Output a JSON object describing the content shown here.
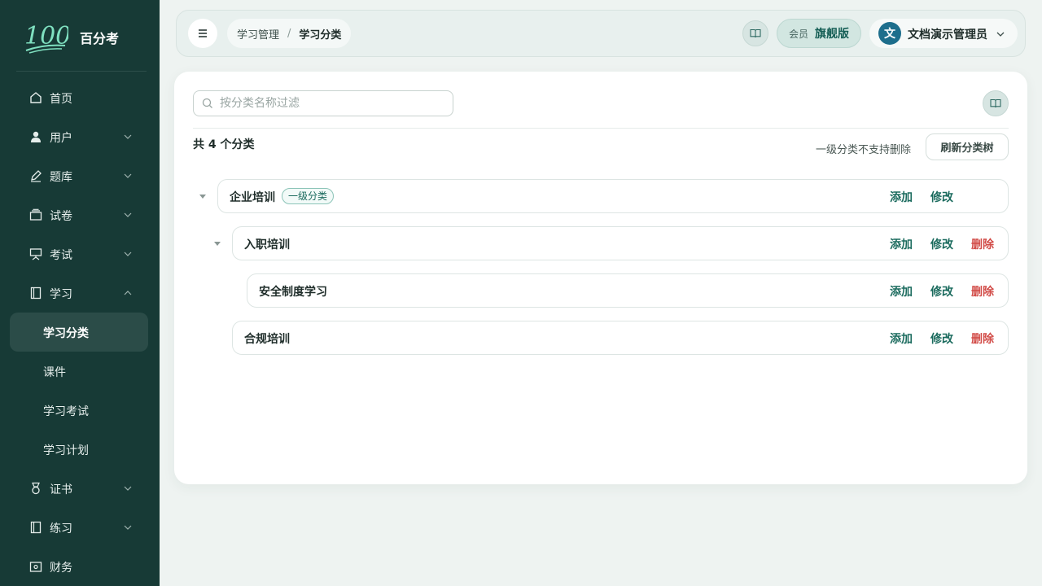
{
  "app": {
    "brand": "百分考",
    "logo_text": "100"
  },
  "sidebar": {
    "items": [
      {
        "label": "首页",
        "icon": "home-icon"
      },
      {
        "label": "用户",
        "icon": "user-icon"
      },
      {
        "label": "题库",
        "icon": "pen-icon"
      },
      {
        "label": "试卷",
        "icon": "stack-icon"
      },
      {
        "label": "考试",
        "icon": "presentation-icon"
      },
      {
        "label": "学习",
        "icon": "notebook-icon"
      },
      {
        "label": "证书",
        "icon": "medal-icon"
      },
      {
        "label": "练习",
        "icon": "notebook-icon"
      },
      {
        "label": "财务",
        "icon": "wallet-icon"
      }
    ],
    "sub_items": [
      {
        "label": "学习分类",
        "active": true
      },
      {
        "label": "课件"
      },
      {
        "label": "学习考试"
      },
      {
        "label": "学习计划"
      }
    ]
  },
  "header": {
    "breadcrumb": [
      "学习管理",
      "学习分类"
    ],
    "breadcrumb_sep": "/",
    "member_label": "会员",
    "member_tier": "旗舰版",
    "user_avatar": "文",
    "user_name": "文档演示管理员"
  },
  "main": {
    "search_placeholder": "按分类名称过滤",
    "count_text": "共 4 个分类",
    "hint": "一级分类不支持删除",
    "refresh_label": "刷新分类树",
    "actions": {
      "add": "添加",
      "edit": "修改",
      "delete": "删除"
    },
    "tree": [
      {
        "name": "企业培训",
        "tag": "一级分类",
        "level": 0,
        "expanded": true
      },
      {
        "name": "入职培训",
        "level": 1,
        "expanded": true
      },
      {
        "name": "安全制度学习",
        "level": 2
      },
      {
        "name": "合规培训",
        "level": 1
      }
    ]
  },
  "colors": {
    "sidebar_bg": "#173a36",
    "accent": "#1b6b5e",
    "danger": "#d24c48"
  }
}
